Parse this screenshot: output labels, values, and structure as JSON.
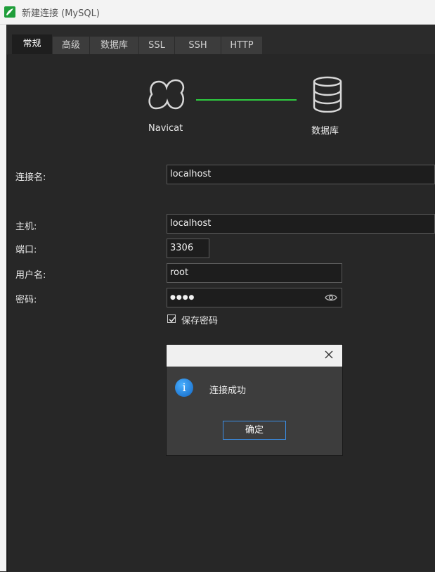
{
  "window": {
    "title": "新建连接 (MySQL)",
    "app_icon": "navicat-app-icon"
  },
  "tabs": [
    {
      "label": "常规",
      "active": true
    },
    {
      "label": "高级",
      "active": false
    },
    {
      "label": "数据库",
      "active": false
    },
    {
      "label": "SSL",
      "active": false
    },
    {
      "label": "SSH",
      "active": false
    },
    {
      "label": "HTTP",
      "active": false
    }
  ],
  "diagram": {
    "left_label": "Navicat",
    "left_icon": "navicat-icon",
    "right_label": "数据库",
    "right_icon": "database-icon",
    "line_color": "#2ecc40"
  },
  "form": {
    "connection_name": {
      "label": "连接名:",
      "value": "localhost"
    },
    "host": {
      "label": "主机:",
      "value": "localhost"
    },
    "port": {
      "label": "端口:",
      "value": "3306"
    },
    "username": {
      "label": "用户名:",
      "value": "root"
    },
    "password": {
      "label": "密码:",
      "value": "●●●●",
      "icon": "eye-icon"
    },
    "save_password": {
      "label": "保存密码",
      "checked": true
    }
  },
  "dialog": {
    "message": "连接成功",
    "icon": "info-icon",
    "ok_label": "确定",
    "close_icon": "close-icon"
  },
  "colors": {
    "accent": "#3a8ee6",
    "success_line": "#2ecc40",
    "background": "#272727"
  }
}
